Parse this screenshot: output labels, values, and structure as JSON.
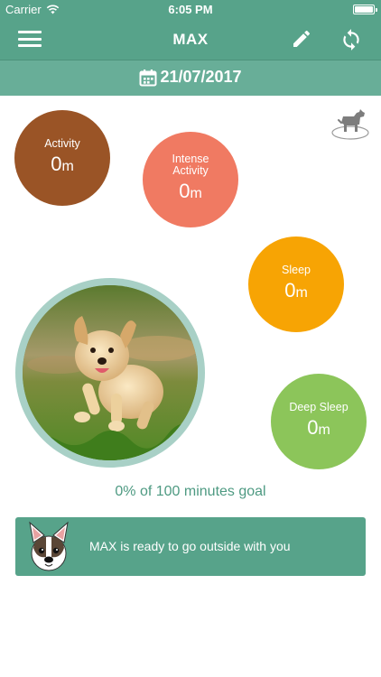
{
  "status_bar": {
    "carrier": "Carrier",
    "time": "6:05 PM"
  },
  "nav": {
    "title": "MAX",
    "menu_icon": "hamburger-menu-icon",
    "edit_icon": "pencil-icon",
    "sync_icon": "sync-icon"
  },
  "date": {
    "value": "21/07/2017",
    "icon": "calendar-icon"
  },
  "metrics": {
    "activity": {
      "label": "Activity",
      "value": "0",
      "unit": "m",
      "color": "#9a5426"
    },
    "intense": {
      "label_line1": "Intense",
      "label_line2": "Activity",
      "value": "0",
      "unit": "m",
      "color": "#f07a62"
    },
    "sleep": {
      "label": "Sleep",
      "value": "0",
      "unit": "m",
      "color": "#f7a404"
    },
    "deep_sleep": {
      "label": "Deep Sleep",
      "value": "0",
      "unit": "m",
      "color": "#8cc55a"
    }
  },
  "goal": {
    "text": "0% of 100 minutes goal"
  },
  "notice": {
    "message": "MAX is ready to go outside with you"
  },
  "colors": {
    "primary": "#57a38a",
    "accent_text": "#4e9a82",
    "photo_ring": "#a8d0c6"
  }
}
